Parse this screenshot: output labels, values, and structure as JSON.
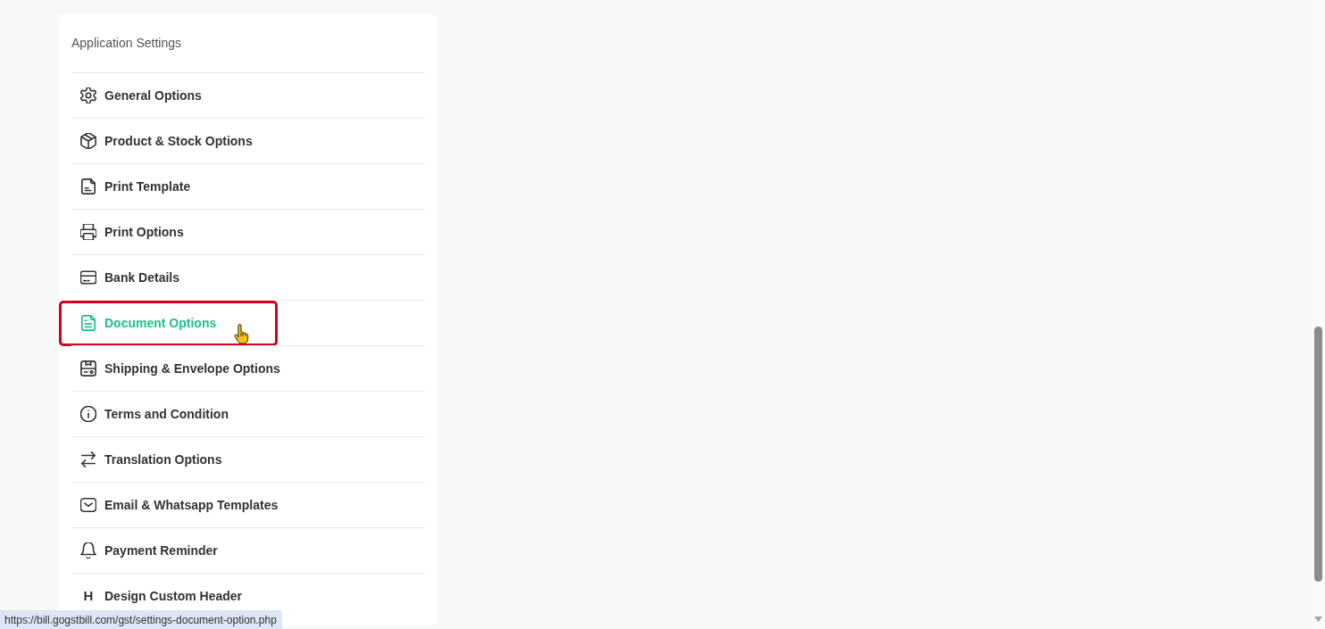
{
  "settings_panel": {
    "title": "Application Settings",
    "items": [
      {
        "label": "General Options",
        "selected": false,
        "highlighted": false,
        "hovered": false
      },
      {
        "label": "Product & Stock Options",
        "selected": false,
        "highlighted": false,
        "hovered": false
      },
      {
        "label": "Print Template",
        "selected": false,
        "highlighted": false,
        "hovered": false
      },
      {
        "label": "Print Options",
        "selected": false,
        "highlighted": false,
        "hovered": false
      },
      {
        "label": "Bank Details",
        "selected": false,
        "highlighted": false,
        "hovered": false
      },
      {
        "label": "Document Options",
        "selected": true,
        "highlighted": true,
        "hovered": true
      },
      {
        "label": "Shipping & Envelope Options",
        "selected": false,
        "highlighted": false,
        "hovered": false
      },
      {
        "label": "Terms and Condition",
        "selected": false,
        "highlighted": false,
        "hovered": false
      },
      {
        "label": "Translation Options",
        "selected": false,
        "highlighted": false,
        "hovered": false
      },
      {
        "label": "Email & Whatsapp Templates",
        "selected": false,
        "highlighted": false,
        "hovered": false
      },
      {
        "label": "Payment Reminder",
        "selected": false,
        "highlighted": false,
        "hovered": false
      },
      {
        "label": "Design Custom Header",
        "glyph": "H",
        "selected": false,
        "highlighted": false,
        "hovered": false
      }
    ]
  },
  "status_bar": {
    "url": "https://bill.gogstbill.com/gst/settings-document-option.php"
  }
}
